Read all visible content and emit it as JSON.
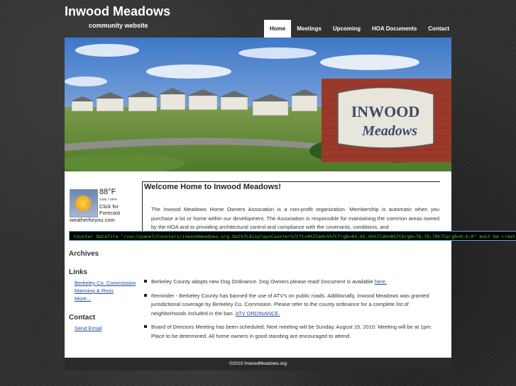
{
  "header": {
    "title": "Inwood Meadows",
    "tagline": "community website"
  },
  "nav": {
    "items": [
      {
        "label": "Home",
        "active": true
      },
      {
        "label": "Meetings",
        "active": false
      },
      {
        "label": "Upcoming",
        "active": false
      },
      {
        "label": "HOA Documents",
        "active": false
      },
      {
        "label": "Contact",
        "active": false
      }
    ]
  },
  "hero": {
    "sign_line1": "INWOOD",
    "sign_line2": "Meadows"
  },
  "weather": {
    "temperature": "88°F",
    "wind": "SSW 7 MPH",
    "click_text": "Click for Forecast",
    "source": "weatherforyou.com"
  },
  "main": {
    "title": "Welcome Home to Inwood Meadows!",
    "intro": "The Inwood Meadows Home Owners Assocation is a non-profit organization. Membership is automatic when you purchase a lot or home within our development. The Association is responsible for maintaining the common areas owned by the HOA and to providing architectural control and compliance with the covenants, conditions, and",
    "counter_error": "Counter datafile \"/var/cpanel/Counters/inwoodmeadows.org.dat%7Cdisplay=Counter%7Cft=4%7Cmd=5%7Cfrgb=65;65;65%7Cdd=B%7Cbrgb=78;78;78%7Cprgb=0;0;0\" must be created first!"
  },
  "sidebar": {
    "archives_heading": "Archives",
    "links_heading": "Links",
    "links": [
      {
        "label": "Berkeley Co. Commission"
      },
      {
        "label": "Manning & Ross"
      },
      {
        "label": "More..."
      }
    ],
    "contact_heading": "Contact",
    "contact_link": "Send Email"
  },
  "news": [
    {
      "text": "Berkeley County adopts new Dog Ordinance. Dog Owners please read! Document is available ",
      "link": "here."
    },
    {
      "text": "Reminder - Berkeley County has banned the use of ATV's on public roads. Additionally, Inwood Meadows was granted jurisdictional coverage by Berkeley Co. Commision. Please refer to the county ordinance for a complete list of neighborhoods included in the ban. ",
      "link": "ATV ORDINANCE."
    },
    {
      "text": "Board of Directors Meeting has been scheduled. Next meeting will be Sunday, August 15, 2010. Meeting will be at 1pm. Place to be determined. All home owners in good standing are encouraged to attend.",
      "link": ""
    }
  ],
  "footer": {
    "copyright": "©2010 InwoodMeadows.org"
  }
}
